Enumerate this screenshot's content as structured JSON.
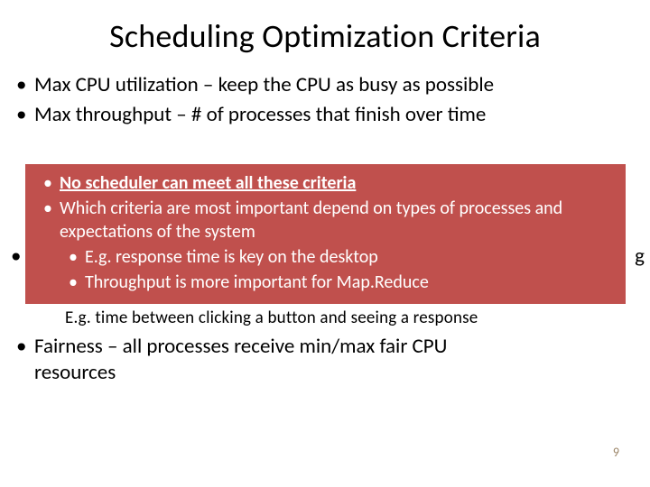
{
  "title": "Scheduling Optimization Criteria",
  "bullets": {
    "b1": "Max CPU utilization – keep the CPU as busy as possible",
    "b2": "Max throughput – # of processes that finish over time"
  },
  "callout": {
    "l1_bold": "No scheduler can meet all these criteria",
    "l2": "Which criteria are most important depend on types of processes and expectations of the system",
    "l3": "E.g. response time is key on the desktop",
    "l4": "Throughput is more important for Map.Reduce"
  },
  "peek_left_bullet": "•",
  "peek_right_char": "g",
  "example_line": "E.g. time between clicking a button and seeing a response",
  "fair_label": "Fairness",
  "fair_rest1": " – all processes receive min/max fair CPU",
  "fair_rest2": "resources",
  "page_number": "9"
}
